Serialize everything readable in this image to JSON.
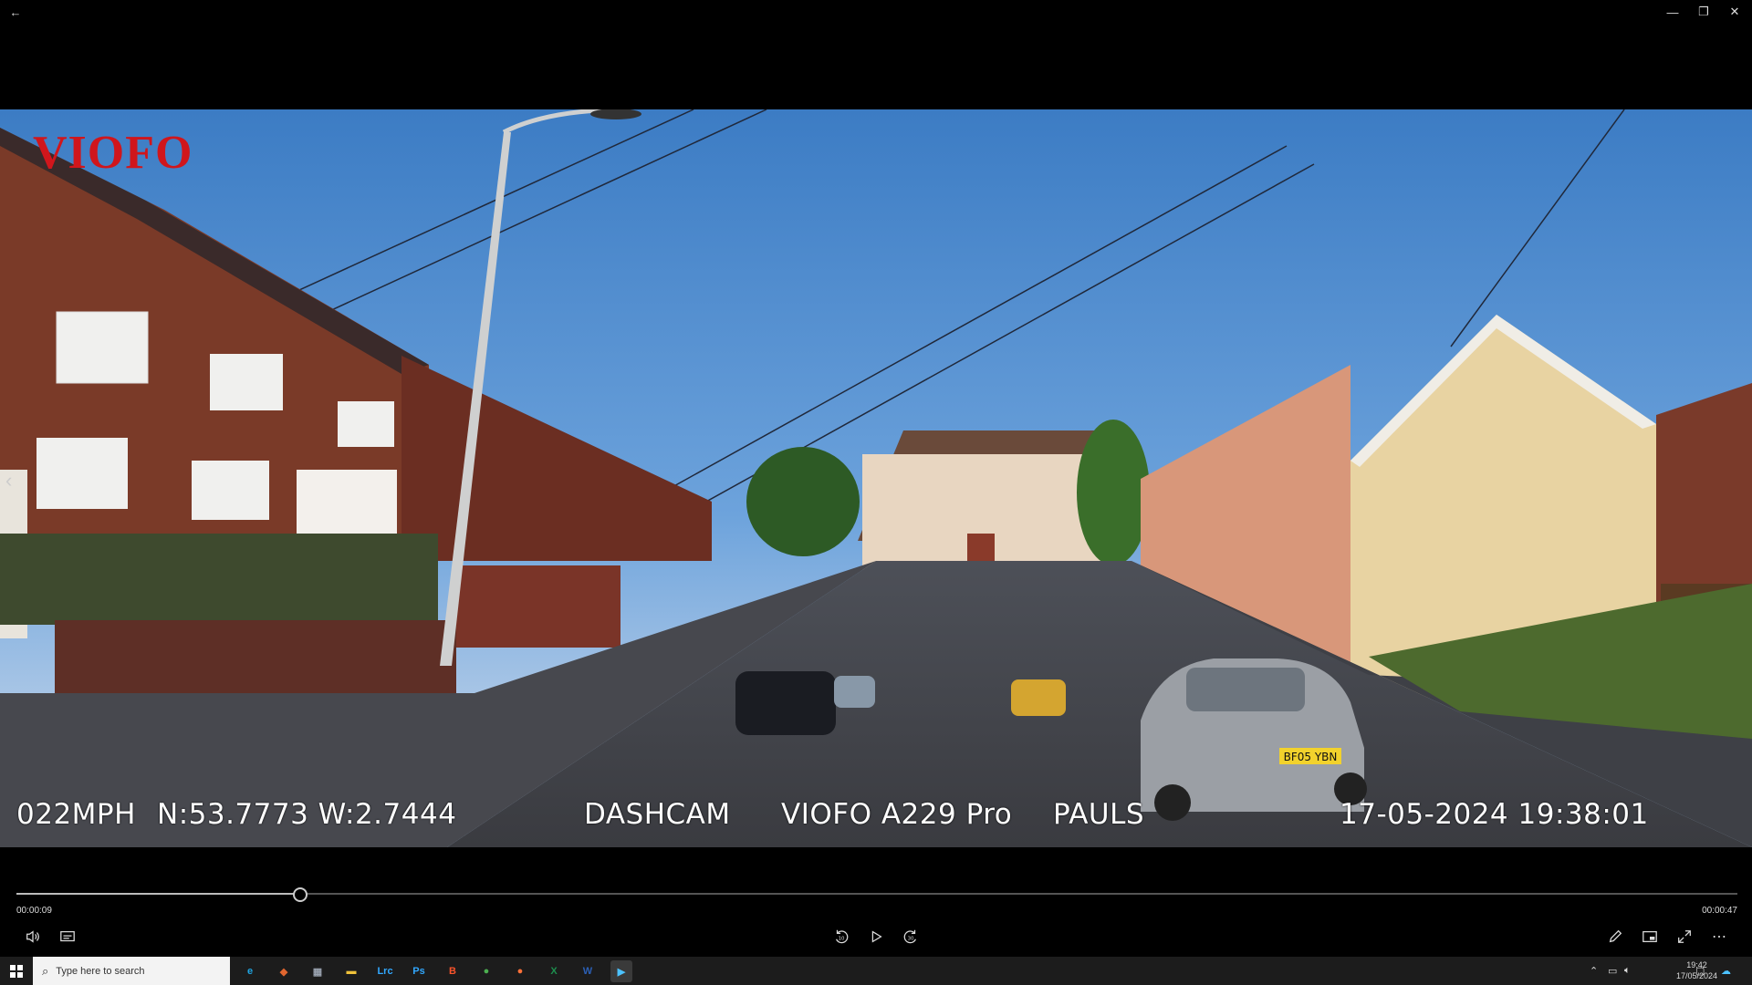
{
  "window": {
    "back_icon": "arrow-left-icon",
    "minimize_icon": "minimize-icon",
    "restore_icon": "restore-icon",
    "close_icon": "close-icon"
  },
  "video": {
    "brand": "VIOFO",
    "brand_color": "#d0161c",
    "osd": {
      "speed": "022MPH",
      "gps": "N:53.7773 W:2.7444",
      "label": "DASHCAM",
      "model": "VIOFO A229 Pro",
      "owner": "PAULS",
      "datetime": "17-05-2024 19:38:01"
    },
    "plates": {
      "front_car": "BF05 YBN"
    }
  },
  "player": {
    "current_time": "00:00:09",
    "total_time": "00:00:47",
    "progress": 0.165,
    "buttons": {
      "volume": "volume-icon",
      "subtitles": "subtitles-icon",
      "rewind": "rewind-10-icon",
      "rewind_label": "10",
      "play": "play-icon",
      "forward": "forward-30-icon",
      "forward_label": "30",
      "edit": "pencil-icon",
      "miniview": "miniview-icon",
      "fullscreen": "fullscreen-icon",
      "more": "more-icon"
    }
  },
  "taskbar": {
    "search_placeholder": "Type here to search",
    "apps": [
      {
        "name": "edge",
        "label": "e",
        "color": "#1fa3e0"
      },
      {
        "name": "paint",
        "label": "◆",
        "color": "#e0662f"
      },
      {
        "name": "calculator",
        "label": "▦",
        "color": "#9aa3b0"
      },
      {
        "name": "file-explorer",
        "label": "▬",
        "color": "#f0c23a"
      },
      {
        "name": "lightroom",
        "label": "Lrc",
        "color": "#31a8ff"
      },
      {
        "name": "photoshop",
        "label": "Ps",
        "color": "#31a8ff"
      },
      {
        "name": "brave",
        "label": "B",
        "color": "#fb542b"
      },
      {
        "name": "chrome",
        "label": "●",
        "color": "#4caf50"
      },
      {
        "name": "firefox",
        "label": "●",
        "color": "#ff7139"
      },
      {
        "name": "excel",
        "label": "X",
        "color": "#1d8f4e"
      },
      {
        "name": "word",
        "label": "W",
        "color": "#2b5fb5"
      },
      {
        "name": "media-player",
        "label": "▶",
        "color": "#4cc2ff"
      }
    ],
    "clock_time": "19:42",
    "clock_date": "17/05/2024"
  }
}
